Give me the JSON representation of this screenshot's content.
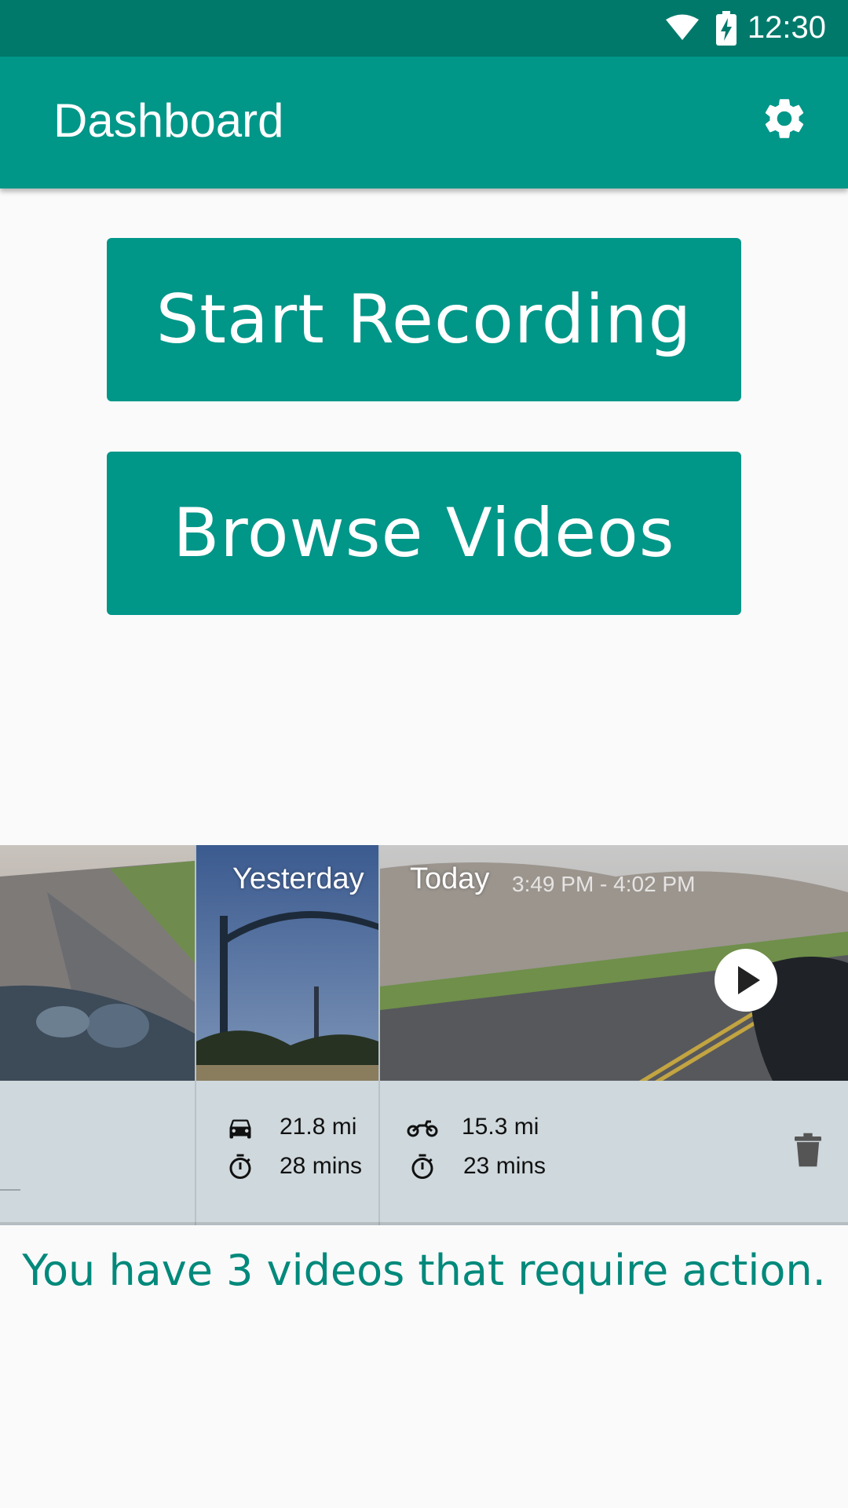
{
  "status_bar": {
    "time": "12:30",
    "icons": [
      "wifi-icon",
      "battery-charging-icon"
    ]
  },
  "app_bar": {
    "title": "Dashboard",
    "settings_icon": "gear-icon"
  },
  "actions": {
    "start_recording": "Start Recording",
    "browse_videos": "Browse Videos"
  },
  "rides": [
    {
      "day": "",
      "time_range": "",
      "distance": "",
      "duration": ""
    },
    {
      "day": "Yesterday",
      "vehicle_icon": "car-icon",
      "distance": "21.8 mi",
      "duration": "28 mins"
    },
    {
      "day": "Today",
      "time_range": "3:49 PM - 4:02 PM",
      "vehicle_icon": "motorcycle-icon",
      "distance": "15.3 mi",
      "duration": "23 mins"
    }
  ],
  "message": "You have 3 videos that require action.",
  "colors": {
    "primary": "#009688",
    "primary_dark": "#00796b",
    "message_text": "#00897b",
    "card_bg": "#cfd8dc"
  }
}
